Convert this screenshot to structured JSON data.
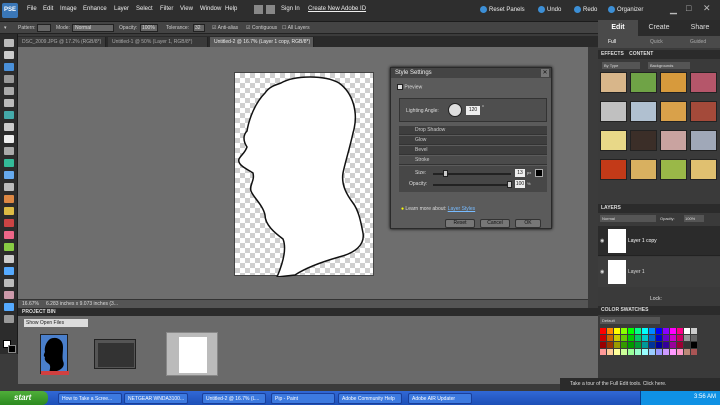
{
  "app": {
    "logo_text": "PSE"
  },
  "menubar": {
    "items": [
      "File",
      "Edit",
      "Image",
      "Enhance",
      "Layer",
      "Select",
      "Filter",
      "View",
      "Window",
      "Help"
    ],
    "sign_in": "Sign In",
    "create_id": "Create New Adobe ID",
    "reset_panels": "Reset Panels",
    "undo": "Undo",
    "redo": "Redo",
    "organizer": "Organizer"
  },
  "right_tabs": {
    "edit": "Edit",
    "create": "Create",
    "share": "Share"
  },
  "edit_subtabs": {
    "full": "Full",
    "quick": "Quick",
    "guided": "Guided"
  },
  "options_bar": {
    "pattern_label": "Pattern:",
    "mode_label": "Mode:",
    "mode_value": "Normal",
    "opacity_label": "Opacity:",
    "opacity_value": "100%",
    "tolerance_label": "Tolerance:",
    "tolerance_value": "32",
    "anti_alias": "Anti-alias",
    "contiguous": "Contiguous",
    "all_layers": "All Layers"
  },
  "doc_tabs": [
    "DSC_2009.JPG @ 17.2% (RGB/8*)",
    "Untitled-1 @ 50% (Layer 1, RGB/8*)",
    "Untitled-2 @ 16.7% (Layer 1 copy, RGB/8*)"
  ],
  "status": {
    "zoom": "16.67%",
    "size": "6.283 inches x 9.073 inches (3..."
  },
  "dialog": {
    "title": "Style Settings",
    "preview": "Preview",
    "lighting_label": "Lighting Angle:",
    "lighting_value": "120",
    "lighting_unit": "°",
    "rows": [
      "Drop Shadow",
      "Glow",
      "Bevel",
      "Stroke"
    ],
    "size_label": "Size:",
    "size_value": "13",
    "size_unit": "px",
    "opacity_label": "Opacity:",
    "opacity_value": "100",
    "opacity_unit": "%",
    "size_fraction": 0.13,
    "opacity_fraction": 1.0,
    "learn_more": "Learn more about:",
    "learn_link": "Layer Styles",
    "reset": "Reset",
    "cancel": "Cancel",
    "ok": "OK"
  },
  "effects": {
    "header": "EFFECTS",
    "tab": "CONTENT",
    "filter1": "By Type",
    "filter2": "Backgrounds",
    "thumb_colors": [
      "#d8b68a",
      "#6fa346",
      "#d79a3c",
      "#b5566a",
      "#c0c0c0",
      "#b0c0d0",
      "#d9a14a",
      "#a44a3a",
      "#e8d888",
      "#3b2e28",
      "#c9a3a0",
      "#a0a8b8",
      "#c33a18",
      "#d8b060",
      "#9ab848",
      "#e0c070"
    ]
  },
  "layers": {
    "header": "LAYERS",
    "mode": "Normal",
    "opacity_label": "Opacity:",
    "opacity_value": "100%",
    "items": [
      "Layer 1 copy",
      "Layer 1"
    ],
    "lock": "Lock:"
  },
  "swatches": {
    "header": "COLOR SWATCHES",
    "preset": "Default",
    "colors": [
      "#f00",
      "#f80",
      "#ff0",
      "#8f0",
      "#0f0",
      "#0f8",
      "#0ff",
      "#08f",
      "#00f",
      "#80f",
      "#f0f",
      "#f08",
      "#fff",
      "#ccc",
      "#c00",
      "#c60",
      "#cc0",
      "#6c0",
      "#0c0",
      "#0c6",
      "#0cc",
      "#06c",
      "#00c",
      "#60c",
      "#c0c",
      "#c06",
      "#999",
      "#666",
      "#900",
      "#930",
      "#990",
      "#390",
      "#090",
      "#093",
      "#099",
      "#039",
      "#009",
      "#309",
      "#909",
      "#903",
      "#333",
      "#000",
      "#f99",
      "#fc9",
      "#ff9",
      "#cf9",
      "#9f9",
      "#9fc",
      "#9ff",
      "#9cf",
      "#99f",
      "#c9f",
      "#f9f",
      "#f9c",
      "#b87",
      "#a55"
    ]
  },
  "project_bin": {
    "header": "PROJECT BIN",
    "dropdown": "Show Open Files"
  },
  "tip": "Take a tour of the Full Edit tools. Click here.",
  "taskbar": {
    "start": "start",
    "tasks": [
      "How to Take a Scree...",
      "NETGEAR WNDA3100...",
      "Untitled-2 @ 16.7% (L...",
      "Pip - Paint",
      "Adobe Community Help",
      "Adobe AIR Updater"
    ],
    "time": "3:56 AM"
  }
}
